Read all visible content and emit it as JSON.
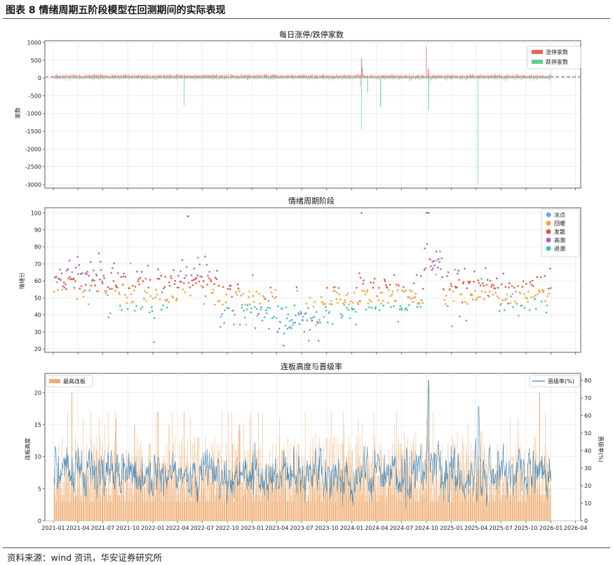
{
  "header": {
    "title": "图表 8 情绪周期五阶段模型在回测期间的实际表现"
  },
  "footer": {
    "source": "资料来源：wind 资讯，华安证券研究所"
  },
  "colors": {
    "up": "#e8665a",
    "down": "#5fd28d",
    "ice": "#5aaee0",
    "warm": "#f2a33a",
    "ferment": "#e05a4a",
    "peak": "#a865c9",
    "retreat": "#3fc3a6",
    "bar": "#efae73",
    "line": "#3f86b8"
  },
  "chart_data": [
    {
      "type": "bar",
      "title": "每日涨停/跌停家数",
      "ylabel": "家数",
      "ylim": [
        -3100,
        1050
      ],
      "yticks": [
        "1000",
        "500",
        "0",
        "-500",
        "-1000",
        "-1500",
        "-2000",
        "-2500",
        "-3000"
      ],
      "ytick_values": [
        1000,
        500,
        0,
        -500,
        -1000,
        -1500,
        -2000,
        -2500,
        -3000
      ],
      "x_range": [
        "2021-01-04",
        "2025-12-31"
      ],
      "legend": [
        "涨停家数",
        "跌停家数"
      ],
      "legend_position": "top-right",
      "series": [
        {
          "name": "涨停家数",
          "typical_range": [
            20,
            110
          ],
          "notable": [
            {
              "date": "2024-02-06",
              "value": 560
            },
            {
              "date": "2024-02-08",
              "value": 280
            },
            {
              "date": "2024-09-30",
              "value": 880
            },
            {
              "date": "2024-10-08",
              "value": 260
            }
          ]
        },
        {
          "name": "跌停家数",
          "typical_range": [
            0,
            -60
          ],
          "notable": [
            {
              "date": "2022-04-25",
              "value": -780
            },
            {
              "date": "2024-02-05",
              "value": -1450
            },
            {
              "date": "2024-02-02",
              "value": -240
            },
            {
              "date": "2024-02-28",
              "value": -400
            },
            {
              "date": "2024-04-16",
              "value": -800
            },
            {
              "date": "2024-10-09",
              "value": -900
            },
            {
              "date": "2025-04-07",
              "value": -3000
            },
            {
              "date": "2024-10-10",
              "value": -180
            }
          ]
        }
      ],
      "reference_line": {
        "y": 30,
        "style": "dashed"
      },
      "grid": true
    },
    {
      "type": "scatter",
      "title": "情绪周期阶段",
      "ylabel": "情绪分",
      "ylim": [
        18,
        103
      ],
      "yticks": [
        "100",
        "90",
        "80",
        "70",
        "60",
        "50",
        "40",
        "30",
        "20"
      ],
      "ytick_values": [
        100,
        90,
        80,
        70,
        60,
        50,
        40,
        30,
        20
      ],
      "x_range": [
        "2021-01-04",
        "2025-12-31"
      ],
      "legend": [
        "冰点",
        "回暖",
        "发散",
        "高潮",
        "退潮"
      ],
      "legend_position": "top-right",
      "series": [
        {
          "name": "冰点"
        },
        {
          "name": "回暖"
        },
        {
          "name": "发散"
        },
        {
          "name": "高潮"
        },
        {
          "name": "退潮"
        }
      ],
      "regime_means": [
        {
          "start": "2021-01-04",
          "end": "2021-06-30",
          "mean": 62
        },
        {
          "start": "2021-07-01",
          "end": "2022-03-31",
          "mean": 55
        },
        {
          "start": "2022-04-01",
          "end": "2022-08-31",
          "mean": 60
        },
        {
          "start": "2022-09-01",
          "end": "2023-03-31",
          "mean": 47
        },
        {
          "start": "2023-04-01",
          "end": "2023-09-30",
          "mean": 40
        },
        {
          "start": "2023-10-01",
          "end": "2024-01-31",
          "mean": 46
        },
        {
          "start": "2024-02-01",
          "end": "2024-09-20",
          "mean": 50
        },
        {
          "start": "2024-09-21",
          "end": "2024-11-30",
          "mean": 72
        },
        {
          "start": "2024-12-01",
          "end": "2025-12-31",
          "mean": 52
        }
      ],
      "notable": [
        {
          "date": "2024-02-06",
          "value": 100
        },
        {
          "date": "2024-09-30",
          "value": 100
        },
        {
          "date": "2024-10-08",
          "value": 100
        },
        {
          "date": "2022-05-10",
          "value": 98
        },
        {
          "date": "2022-01-05",
          "value": 24
        },
        {
          "date": "2023-04-25",
          "value": 22
        }
      ],
      "grid": true
    },
    {
      "type": "bar",
      "title": "连板高度与晋级率",
      "ylabel": "连板高度",
      "ylabel_right": "晋级率(%)",
      "ylim": [
        0,
        23
      ],
      "ylim_right": [
        0,
        84
      ],
      "yticks": [
        "0",
        "5",
        "10",
        "15",
        "20"
      ],
      "ytick_values": [
        0,
        5,
        10,
        15,
        20
      ],
      "yticks_right": [
        "0",
        "10",
        "20",
        "30",
        "40",
        "50",
        "60",
        "70",
        "80"
      ],
      "ytick_values_right": [
        0,
        10,
        20,
        30,
        40,
        50,
        60,
        70,
        80
      ],
      "xticks": [
        "2021-01",
        "2021-04",
        "2021-07",
        "2021-10",
        "2022-01",
        "2022-04",
        "2022-07",
        "2022-10",
        "2023-01",
        "2023-04",
        "2023-07",
        "2023-10",
        "2024-01",
        "2024-04",
        "2024-07",
        "2024-10",
        "2025-01",
        "2025-04",
        "2025-07",
        "2025-10",
        "2026-01",
        "2026-04"
      ],
      "x_range": [
        "2021-01-04",
        "2025-12-31"
      ],
      "axis_end": "2026-04",
      "series": [
        {
          "name": "最高连板",
          "typical_range": [
            3,
            13
          ],
          "notable": [
            {
              "date": "2021-03-10",
              "value": 20
            },
            {
              "date": "2021-08-20",
              "value": 16
            },
            {
              "date": "2022-01-20",
              "value": 17
            },
            {
              "date": "2022-04-25",
              "value": 17
            },
            {
              "date": "2022-11-15",
              "value": 15
            },
            {
              "date": "2024-10-10",
              "value": 21
            },
            {
              "date": "2025-11-20",
              "value": 20
            }
          ]
        },
        {
          "name": "晋级率(%)",
          "typical_range": [
            12,
            40
          ],
          "notable": [
            {
              "date": "2024-10-08",
              "value": 80
            },
            {
              "date": "2025-04-10",
              "value": 65
            },
            {
              "date": "2021-02-20",
              "value": 42
            },
            {
              "date": "2024-07-20",
              "value": 42
            }
          ]
        }
      ],
      "legend_left": [
        "最高连板"
      ],
      "legend_right": [
        "晋级率(%)"
      ],
      "grid": true
    }
  ]
}
